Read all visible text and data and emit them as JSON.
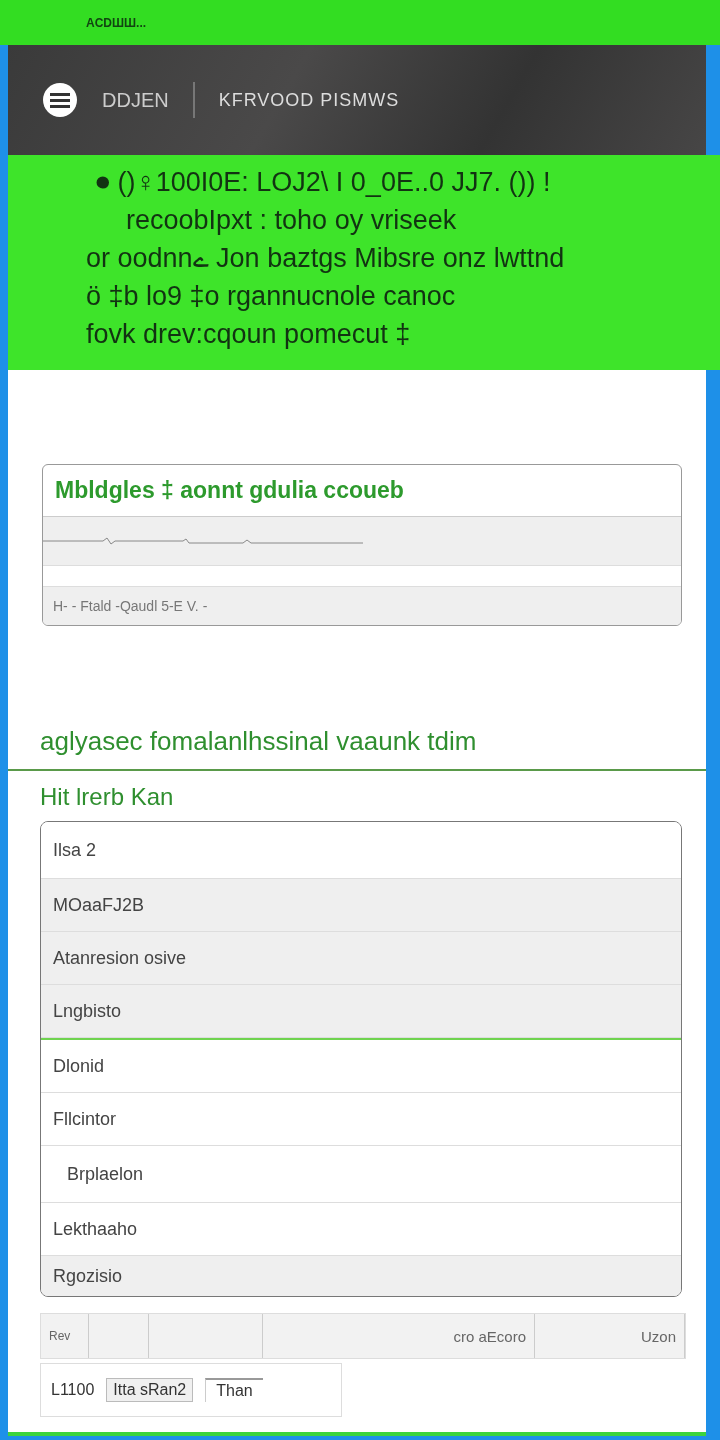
{
  "top_bar": {
    "text": "ACDШШ..."
  },
  "header": {
    "brand": "DDJEN",
    "title": "KFRVOOD PISMWS"
  },
  "hero": {
    "lines": [
      "⏺ ()♀100I0E: LOJ2\\ I 0_0E..0 JJ7. ()) !",
      "recoobIpxt : toho oy vriseek",
      "or oodnnے Jon baztgs Mibsre onz lwttnd",
      "ö ‡b lo9 ‡o rgannucnole canoc",
      "fovk drev:cqoun pomecut ‡"
    ]
  },
  "card": {
    "title": "Mbldgles ‡ aonnt gdulia ccoueb",
    "rows": [
      {
        "kind": "rule"
      },
      {
        "kind": "blank"
      },
      {
        "kind": "text",
        "text": "H- - Ftald -Qaudl 5-E V. -"
      }
    ]
  },
  "section": {
    "heading": "aglyasec fomalanlhssinal vaaunk tdim",
    "subheading": "Hit lrerb Kan"
  },
  "list": [
    {
      "label": "Ilsa 2",
      "selected": false
    },
    {
      "label": "MOaaFJ2B",
      "selected": true
    },
    {
      "label": "Atanresion osive",
      "selected": true
    },
    {
      "label": "Lngbisto",
      "selected": true
    },
    {
      "label": "Dlonid",
      "selected": false
    },
    {
      "label": "Fllcintor",
      "selected": false,
      "children": [
        {
          "label": "Brplaelon",
          "selected": false
        }
      ]
    },
    {
      "label": "Lekthaaho",
      "selected": false
    },
    {
      "label": "Rgozisio",
      "selected": true
    }
  ],
  "table_row": {
    "cells": [
      "Rev",
      "",
      "",
      "cro aEcoro",
      "Uzon"
    ]
  },
  "footer": {
    "label": "L1100",
    "button": "Itta sRan2",
    "tab": "Than"
  }
}
